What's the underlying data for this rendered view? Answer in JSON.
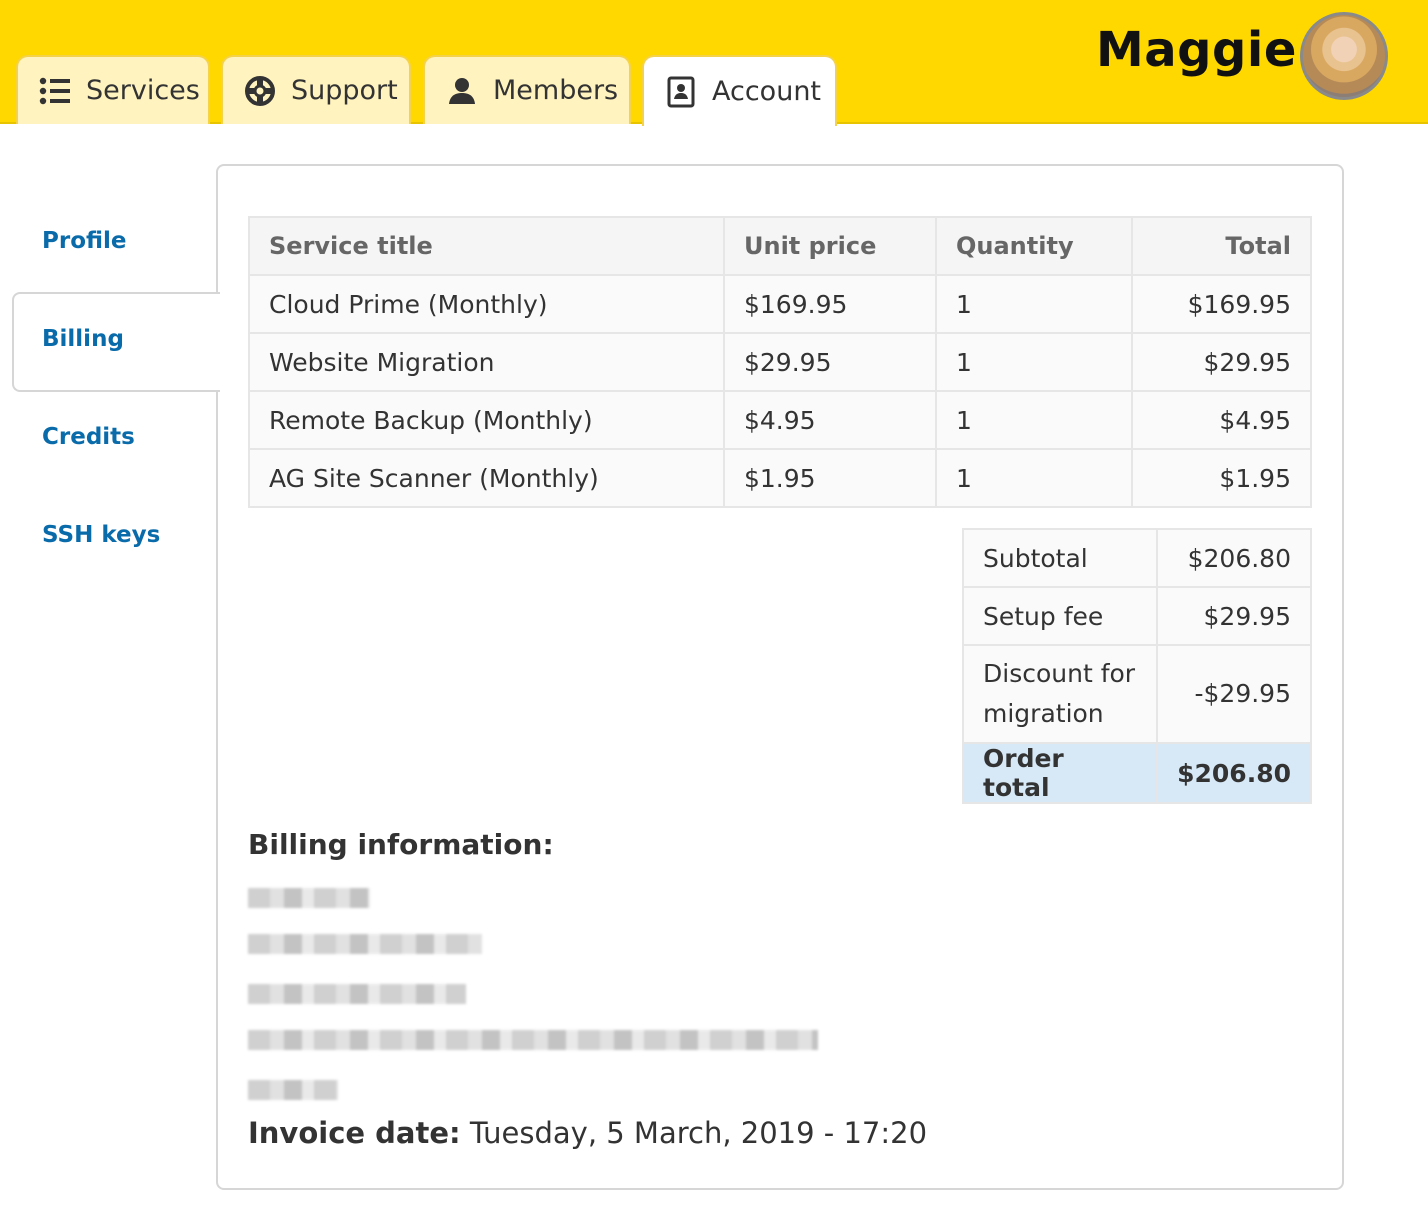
{
  "header": {
    "tabs": [
      {
        "label": "Services",
        "icon": "list-icon"
      },
      {
        "label": "Support",
        "icon": "lifebuoy-icon"
      },
      {
        "label": "Members",
        "icon": "user-icon"
      },
      {
        "label": "Account",
        "icon": "contact-card-icon",
        "active": true
      }
    ],
    "user_name": "Maggie",
    "brand_color": "#FFD800"
  },
  "sidebar": {
    "items": [
      {
        "label": "Profile"
      },
      {
        "label": "Billing",
        "active": true
      },
      {
        "label": "Credits"
      },
      {
        "label": "SSH keys"
      }
    ],
    "link_color": "#0A6BAA"
  },
  "invoice_table": {
    "headers": [
      "Service title",
      "Unit price",
      "Quantity",
      "Total"
    ],
    "rows": [
      {
        "title": "Cloud Prime (Monthly)",
        "unit_price": "$169.95",
        "quantity": "1",
        "total": "$169.95"
      },
      {
        "title": "Website Migration",
        "unit_price": "$29.95",
        "quantity": "1",
        "total": "$29.95"
      },
      {
        "title": "Remote Backup (Monthly)",
        "unit_price": "$4.95",
        "quantity": "1",
        "total": "$4.95"
      },
      {
        "title": "AG Site Scanner (Monthly)",
        "unit_price": "$1.95",
        "quantity": "1",
        "total": "$1.95"
      }
    ]
  },
  "totals": {
    "subtotal_label": "Subtotal",
    "subtotal_value": "$206.80",
    "setup_label": "Setup fee",
    "setup_value": "$29.95",
    "discount_label": "Discount for migration",
    "discount_value": "-$29.95",
    "order_label": "Order total",
    "order_value": "$206.80"
  },
  "billing": {
    "title": "Billing information:"
  },
  "invoice_date": {
    "label": "Invoice date:",
    "value": "Tuesday, 5 March, 2019 - 17:20"
  }
}
